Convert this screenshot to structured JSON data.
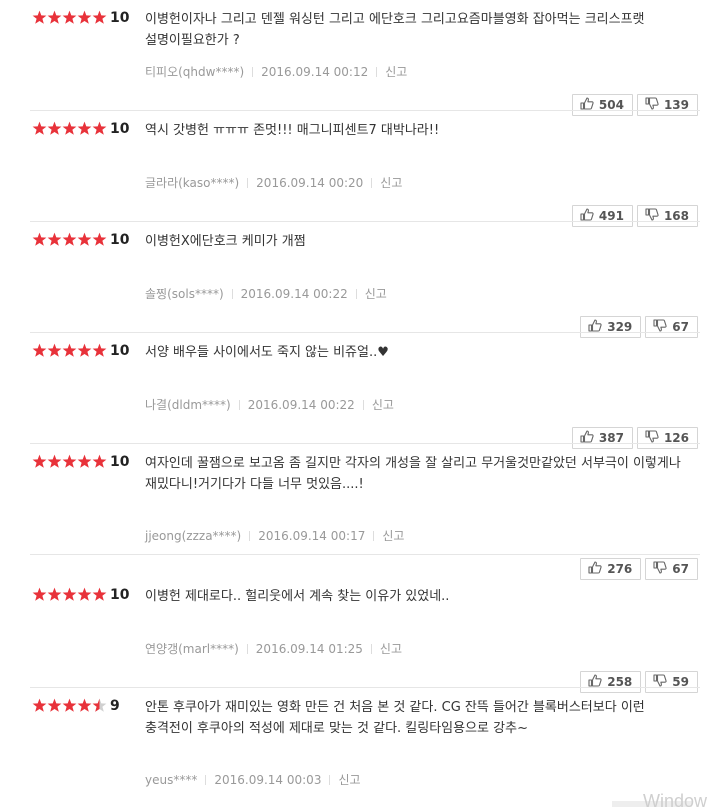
{
  "reviews": [
    {
      "rating": 5,
      "score": "10",
      "text": "이병헌이자나 그리고 덴젤 워싱턴 그리고 에단호크 그리고요즘마블영화 잡아먹는 크리스프랫 설명이필요한가 ?",
      "author": "티피오(qhdw****)",
      "date": "2016.09.14 00:12",
      "report": "신고",
      "likes": "504",
      "dislikes": "139"
    },
    {
      "rating": 5,
      "score": "10",
      "text": "역시 갓병헌 ㅠㅠㅠ 존멋!!! 매그니피센트7 대박나라!!",
      "author": "글라라(kaso****)",
      "date": "2016.09.14 00:20",
      "report": "신고",
      "likes": "491",
      "dislikes": "168"
    },
    {
      "rating": 5,
      "score": "10",
      "text": "이병헌X에단호크 케미가 개쩜",
      "author": "솔찡(sols****)",
      "date": "2016.09.14 00:22",
      "report": "신고",
      "likes": "329",
      "dislikes": "67"
    },
    {
      "rating": 5,
      "score": "10",
      "text": "서양 배우들 사이에서도 죽지 않는 비쥬얼..♥",
      "author": "나결(dldm****)",
      "date": "2016.09.14 00:22",
      "report": "신고",
      "likes": "387",
      "dislikes": "126"
    },
    {
      "rating": 5,
      "score": "10",
      "text": "여자인데 꿀잼으로 보고옴 좀 길지만 각자의 개성을 잘 살리고 무거울것만같았던 서부극이 이렇게나 재밌다니!거기다가 다들 너무 멋있음....!",
      "author": "jjeong(zzza****)",
      "date": "2016.09.14 00:17",
      "report": "신고",
      "likes": "276",
      "dislikes": "67"
    },
    {
      "rating": 5,
      "score": "10",
      "text": "이병헌 제대로다.. 헐리웃에서 계속 찾는 이유가 있었네..",
      "author": "연양갱(marl****)",
      "date": "2016.09.14 01:25",
      "report": "신고",
      "likes": "258",
      "dislikes": "59"
    },
    {
      "rating": 4.5,
      "score": "9",
      "text": "안톤 후쿠아가 재미있는 영화 만든 건 처음 본 것 같다. CG 잔뜩 들어간 블록버스터보다 이런 충격전이 후쿠아의 적성에 제대로 맞는 것 같다. 킬링타임용으로 강추~",
      "author": "yeus****",
      "date": "2016.09.14 00:03",
      "report": "신고",
      "likes": "",
      "dislikes": ""
    }
  ],
  "watermark": "Window",
  "colors": {
    "star": "#e8323a",
    "star_empty": "#d0d0d0",
    "meta": "#999999",
    "border": "#d5d5d5"
  },
  "icons": {
    "like": "thumbs-up-icon",
    "dislike": "thumbs-down-icon",
    "star": "star-icon"
  }
}
